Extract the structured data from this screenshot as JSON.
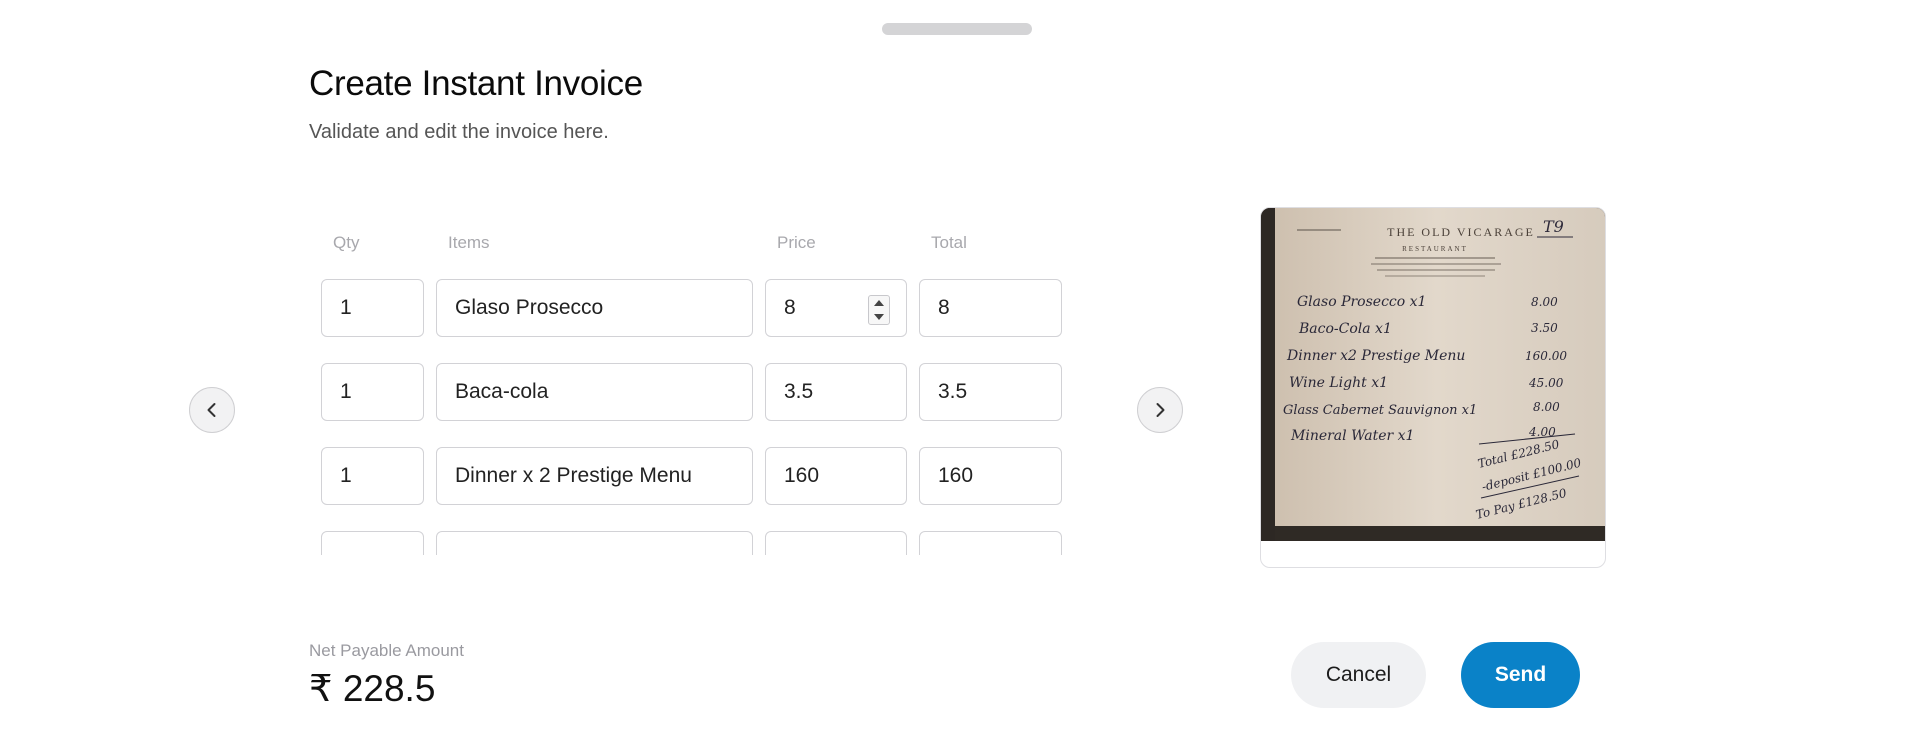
{
  "modal": {
    "title": "Create Instant Invoice",
    "subtitle": "Validate and edit the invoice here."
  },
  "table": {
    "headers": {
      "qty": "Qty",
      "items": "Items",
      "price": "Price",
      "total": "Total"
    },
    "rows": [
      {
        "qty": "1",
        "item": "Glaso Prosecco",
        "price": "8",
        "total": "8"
      },
      {
        "qty": "1",
        "item": "Baca-cola",
        "price": "3.5",
        "total": "3.5"
      },
      {
        "qty": "1",
        "item": "Dinner x 2 Prestige Menu",
        "price": "160",
        "total": "160"
      },
      {
        "qty": "",
        "item": "",
        "price": "",
        "total": ""
      }
    ]
  },
  "receipt": {
    "header_name": "THE OLD VICARAGE",
    "header_sub": "RESTAURANT",
    "table_no": "T9",
    "lines": [
      {
        "item": "Glaso Prosecco x1",
        "amount": "8.00"
      },
      {
        "item": "Baco-Cola x1",
        "amount": "3.50"
      },
      {
        "item": "Dinner x2 Prestige Menu",
        "amount": "160.00"
      },
      {
        "item": "Wine Light x1",
        "amount": "45.00"
      },
      {
        "item": "Glass Cabernet Sauvignon x1",
        "amount": "8.00"
      },
      {
        "item": "Mineral Water x1",
        "amount": "4.00"
      }
    ],
    "totals": [
      "Total £228.50",
      "-deposit £100.00",
      "To Pay £128.50"
    ]
  },
  "summary": {
    "net_label": "Net Payable Amount",
    "net_amount": "₹ 228.5"
  },
  "actions": {
    "cancel_label": "Cancel",
    "send_label": "Send"
  },
  "colors": {
    "primary": "#0a82c8",
    "cancel_bg": "#f0f1f3",
    "border": "#d2d2d6"
  },
  "icons": {
    "prev": "chevron-left-icon",
    "next": "chevron-right-icon"
  }
}
